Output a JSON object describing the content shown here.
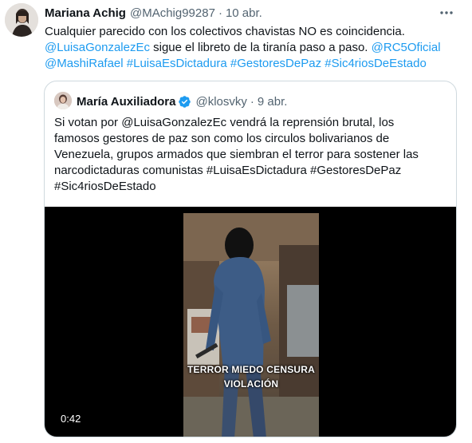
{
  "tweet": {
    "author": {
      "name": "Mariana Achig",
      "handle": "@MAchig99287",
      "separator": "·",
      "date": "10 abr."
    },
    "text_plain": "Cualquier parecido con los colectivos chavistas NO es coincidencia.",
    "mention_1": "@LuisaGonzalezEc",
    "text_mid": " sigue el libreto de la tiranía paso a paso. ",
    "mention_2": "@RC5Oficial",
    "mention_3": "@MashiRafael",
    "hashtag_1": "#LuisaEsDictadura",
    "hashtag_2": "#GestoresDePaz",
    "hashtag_3": "#Sic4riosDeEstado",
    "more_icon": "more-horizontal-icon"
  },
  "quoted": {
    "author": {
      "name": "María Auxiliadora",
      "handle": "@klosvky",
      "separator": "·",
      "date": "9 abr.",
      "verified_icon": "verified-badge-icon"
    },
    "line_1": "Si votan por @LuisaGonzalezEc vendrá la reprensión brutal, los",
    "line_2": "famosos gestores de paz son como los circulos bolivarianos de",
    "line_3": "Venezuela, grupos armados que siembran el terror para sostener las",
    "line_4": "narcodictaduras comunistas #LuisaEsDictadura #GestoresDePaz",
    "line_5": "#Sic4riosDeEstado",
    "media": {
      "caption_line_1": "TERROR MIEDO CENSURA",
      "caption_line_2": "VIOLACIÓN",
      "duration": "0:42"
    }
  },
  "colors": {
    "link": "#1d9bf0",
    "text": "#0f1419",
    "secondary": "#536471",
    "border": "#cfd9de",
    "verified": "#1d9bf0"
  }
}
